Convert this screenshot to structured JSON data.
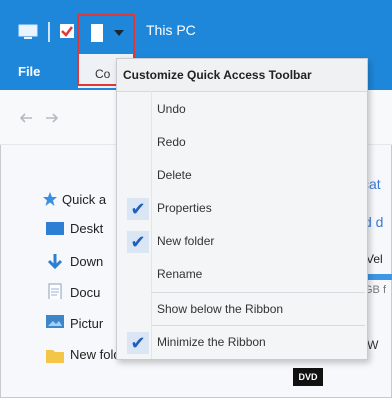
{
  "window": {
    "title": "This PC",
    "accent_color": "#1f87d9"
  },
  "ribbon": {
    "file_tab": "File",
    "partial_tab": "Co"
  },
  "navigation": {
    "items": [
      {
        "label": "Quick a",
        "icon": "star-icon"
      },
      {
        "label": "Deskt",
        "icon": "desktop-icon"
      },
      {
        "label": "Down",
        "icon": "download-icon"
      },
      {
        "label": "Docu",
        "icon": "document-icon"
      },
      {
        "label": "Pictur",
        "icon": "pictures-icon"
      },
      {
        "label": "New folder",
        "icon": "folder-icon"
      }
    ]
  },
  "content_fragments": {
    "f1": "cat",
    "f2": "d d",
    "f3": "Vel",
    "f4": "GB f",
    "f5": "DVD RW",
    "dvd_badge": "DVD"
  },
  "menu": {
    "title": "Customize Quick Access Toolbar",
    "items": [
      {
        "label": "Undo",
        "checked": false
      },
      {
        "label": "Redo",
        "checked": false
      },
      {
        "label": "Delete",
        "checked": false
      },
      {
        "label": "Properties",
        "checked": true
      },
      {
        "label": "New folder",
        "checked": true
      },
      {
        "label": "Rename",
        "checked": false
      },
      {
        "label": "Show below the Ribbon",
        "checked": false
      },
      {
        "label": "Minimize the Ribbon",
        "checked": true
      }
    ],
    "check_glyph": "✔"
  }
}
